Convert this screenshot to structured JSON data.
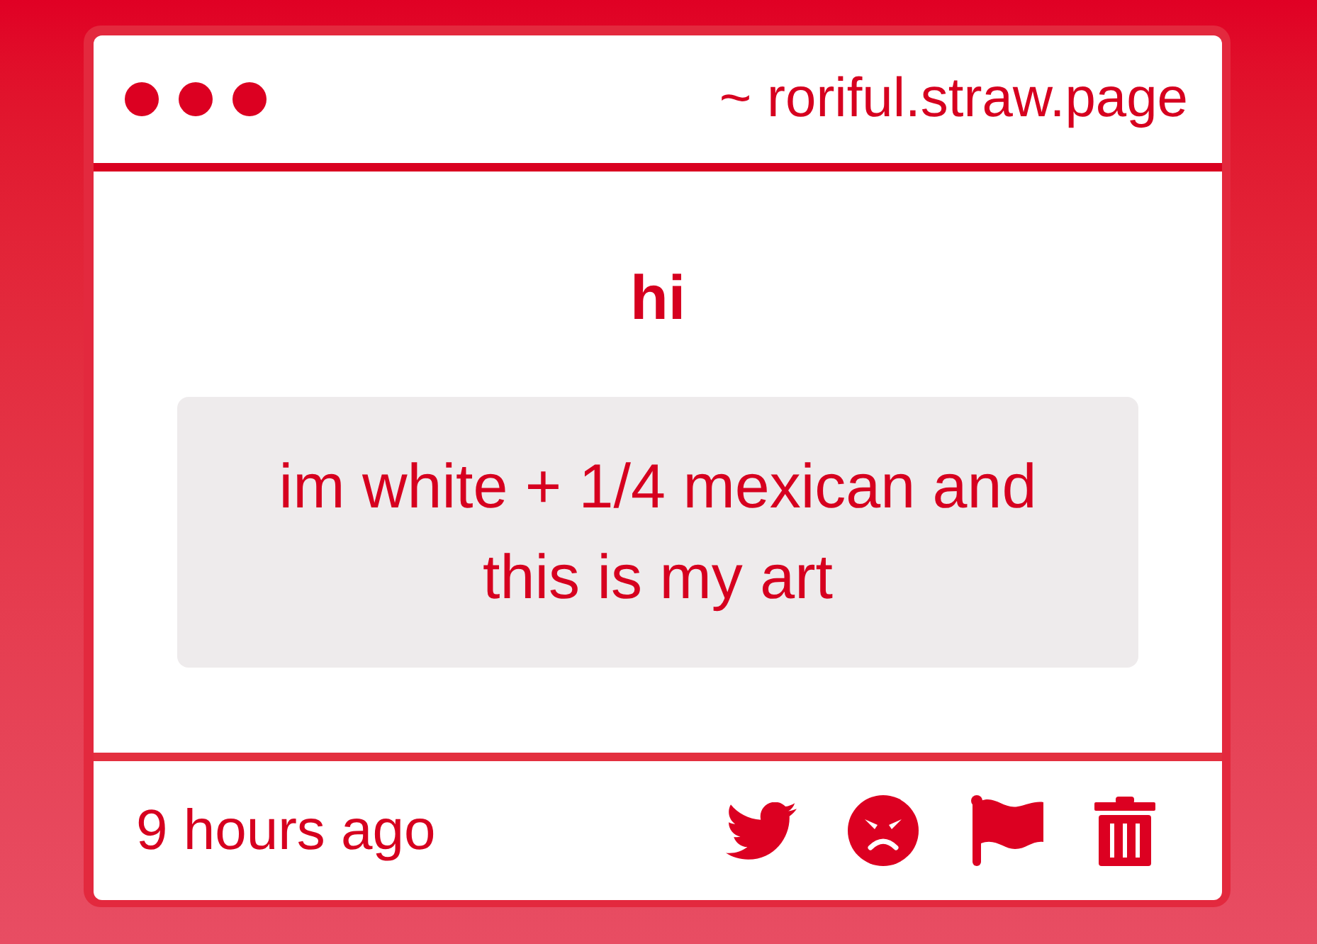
{
  "header": {
    "address": "~ roriful.straw.page"
  },
  "post": {
    "title": "hi",
    "body": "im white + 1/4 mexican and this is my art"
  },
  "footer": {
    "time": "9 hours ago"
  }
}
